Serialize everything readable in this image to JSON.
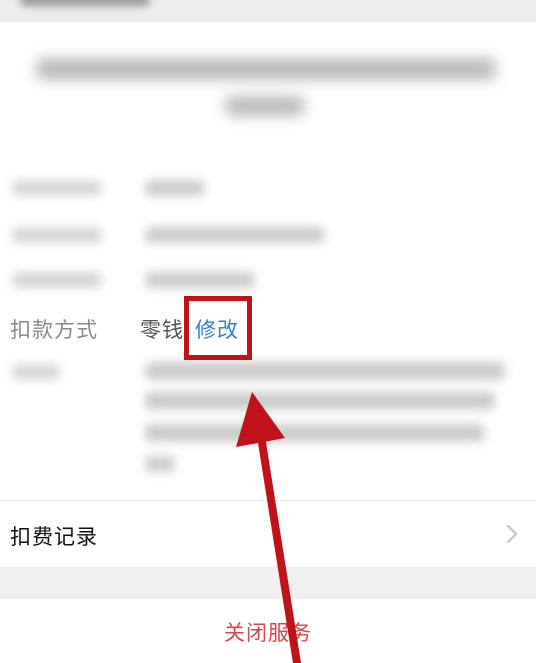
{
  "payment": {
    "label": "扣款方式",
    "value": "零钱",
    "modify": "修改"
  },
  "records": {
    "label": "扣费记录"
  },
  "close": {
    "label": "关闭服务"
  },
  "colors": {
    "link": "#2e7fd6",
    "danger": "#d7464a",
    "highlight": "#c0121b"
  },
  "icons": [
    "chevron-right-icon",
    "arrow-annotation-icon"
  ]
}
